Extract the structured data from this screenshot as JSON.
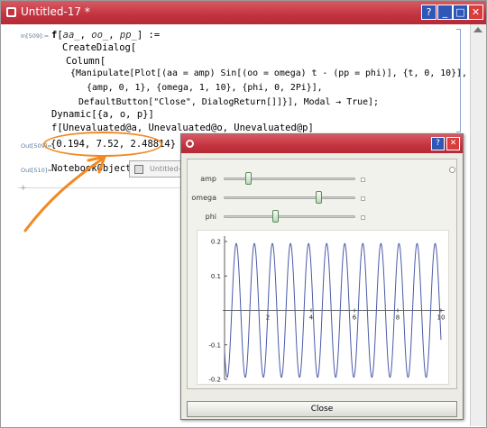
{
  "window": {
    "title": "Untitled-17 *",
    "buttons": {
      "help": "?",
      "minimize": "_",
      "maximize": "□",
      "close": "✕"
    }
  },
  "cells": {
    "in509_label": "In[509]:=",
    "input_lines": [
      "f[aa_, oo_, pp_] :=",
      "CreateDialog[",
      "Column[",
      "{Manipulate[Plot[(aa = amp) Sin[(oo = omega) t - (pp = phi)], {t, 0, 10}],",
      "{amp, 0, 1}, {omega, 1, 10}, {phi, 0, 2Pi}],",
      "DefaultButton[\"Close\", DialogReturn[]]}], Modal → True];",
      "Dynamic[{a, o, p}]",
      "f[Unevaluated@a, Unevaluated@o, Unevaluated@p]"
    ],
    "out509_label": "Out[509]=",
    "out509_value": "{0.194, 7.52, 2.48814}",
    "out510_label": "Out[510]=",
    "out510_value": "NotebookObject",
    "notebook_button_label": "Untitled-2"
  },
  "dialog": {
    "buttons": {
      "help": "?",
      "close": "✕"
    },
    "controls": [
      {
        "label": "amp",
        "value": 0.194,
        "min": 0,
        "max": 1
      },
      {
        "label": "omega",
        "value": 7.52,
        "min": 1,
        "max": 10
      },
      {
        "label": "phi",
        "value": 2.48814,
        "min": 0,
        "max": 6.2832
      }
    ],
    "close_label": "Close"
  },
  "colors": {
    "titlebar": "#c2333f",
    "annotation": "#f28a22",
    "curve": "#4a5aa8",
    "slider_thumb": "#5a8a5a"
  },
  "chart_data": {
    "type": "line",
    "function": "amp*Sin[omega*t - phi]",
    "amp": 0.194,
    "omega": 7.52,
    "phi": 2.48814,
    "xlim": [
      0,
      10
    ],
    "ylim": [
      -0.2,
      0.2
    ],
    "x_ticks": [
      "2",
      "4",
      "6",
      "8",
      "10"
    ],
    "y_ticks": [
      "0.2",
      "0.1",
      "-0.1",
      "-0.2"
    ]
  }
}
